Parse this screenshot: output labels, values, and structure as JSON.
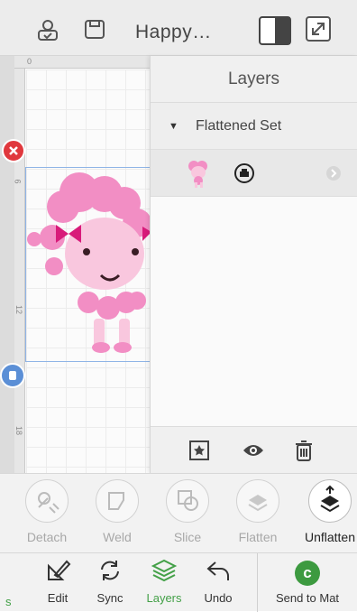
{
  "header": {
    "title": "Happy…",
    "icons": [
      "account-icon",
      "save-icon",
      "mat-toggle-icon",
      "expand-icon"
    ]
  },
  "canvas": {
    "ruler_top_marks": [
      "0"
    ],
    "ruler_left_marks": [
      "6",
      "12",
      "18"
    ]
  },
  "layers": {
    "title": "Layers",
    "set_label": "Flattened Set",
    "item_icon": "print-then-cut-icon",
    "footer_icons": [
      "group-icon",
      "visibility-icon",
      "delete-icon"
    ]
  },
  "actions": [
    {
      "label": "Detach",
      "active": false
    },
    {
      "label": "Weld",
      "active": false
    },
    {
      "label": "Slice",
      "active": false
    },
    {
      "label": "Flatten",
      "active": false
    },
    {
      "label": "Unflatten",
      "active": true
    }
  ],
  "nav": {
    "partial_label": "s",
    "items": [
      {
        "label": "Edit"
      },
      {
        "label": "Sync"
      },
      {
        "label": "Layers",
        "active": true
      },
      {
        "label": "Undo"
      }
    ],
    "send_label": "Send to Mat",
    "send_icon": "c"
  },
  "colors": {
    "accent_green": "#43a047",
    "send_green": "#3d9a40",
    "handle_red": "#e0383d",
    "handle_blue": "#5b8fd6",
    "poodle_pink": "#f28ec4"
  }
}
